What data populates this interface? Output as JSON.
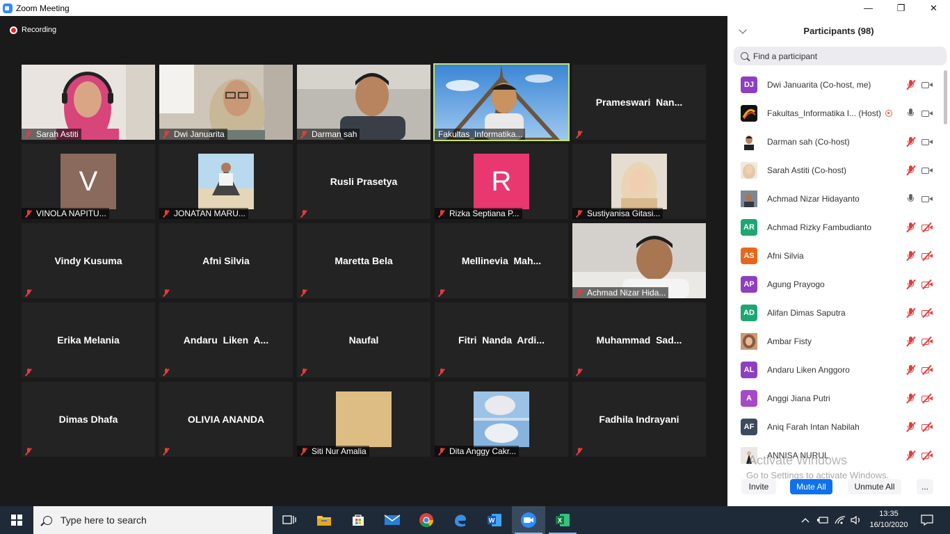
{
  "window": {
    "title": "Zoom Meeting",
    "controls": [
      "—",
      "❐",
      "✕"
    ]
  },
  "meeting": {
    "recording_label": "Recording",
    "tiles": [
      {
        "name": "Sarah Astiti",
        "kind": "video",
        "photo": "woman-pink-hijab-headset"
      },
      {
        "name": "Dwi Januarita",
        "kind": "video",
        "photo": "woman-hijab-glasses"
      },
      {
        "name": "Darman sah",
        "kind": "video",
        "photo": "man-dark-shirt"
      },
      {
        "name": "Fakultas_Informatika...",
        "kind": "video",
        "photo": "man-eiffel-tower",
        "active_speaker": true
      },
      {
        "name": "Prameswari  Nan...",
        "kind": "name"
      },
      {
        "name": "VINOLA NAPITU...",
        "kind": "avatar",
        "letter": "V",
        "color": "#8a6a5c"
      },
      {
        "name": "JONATAN MARU...",
        "kind": "picture",
        "photo": "man-beach-chair"
      },
      {
        "name": "Rusli Prasetya",
        "kind": "name"
      },
      {
        "name": "Rizka Septiana P...",
        "kind": "avatar",
        "letter": "R",
        "color": "#e8386f"
      },
      {
        "name": "Sustiyanisa Gitasi...",
        "kind": "picture",
        "photo": "woman-hijab-portrait"
      },
      {
        "name": "Vindy Kusuma",
        "kind": "name"
      },
      {
        "name": "Afni Silvia",
        "kind": "name"
      },
      {
        "name": "Maretta Bela",
        "kind": "name"
      },
      {
        "name": "Mellinevia  Mah...",
        "kind": "name"
      },
      {
        "name": "Achmad Nizar Hida...",
        "kind": "video",
        "photo": "man-white-room"
      },
      {
        "name": "Erika Melania",
        "kind": "name"
      },
      {
        "name": "Andaru  Liken  A...",
        "kind": "name"
      },
      {
        "name": "Naufal",
        "kind": "name"
      },
      {
        "name": "Fitri  Nanda  Ardi...",
        "kind": "name"
      },
      {
        "name": "Muhammad  Sad...",
        "kind": "name"
      },
      {
        "name": "Dimas Dhafa",
        "kind": "name"
      },
      {
        "name": "OLIVIA ANANDA",
        "kind": "name"
      },
      {
        "name": "Siti Nur Amalia",
        "kind": "picture",
        "photo": "tan-square"
      },
      {
        "name": "Dita Anggy Cakr...",
        "kind": "picture",
        "photo": "collage-photos"
      },
      {
        "name": "Fadhila Indrayani",
        "kind": "name"
      }
    ]
  },
  "participants": {
    "title": "Participants (98)",
    "search_placeholder": "Find a participant",
    "list": [
      {
        "name": "Dwi Januarita (Co-host, me)",
        "initials": "DJ",
        "color": "#8e3fc1",
        "mic": "muted",
        "cam": "on"
      },
      {
        "name": "Fakultas_Informatika I... (Host)",
        "initials": "",
        "color": "#2b2b2b",
        "logo": true,
        "mic": "on",
        "cam": "on",
        "hosting": true
      },
      {
        "name": "Darman sah (Co-host)",
        "initials": "",
        "color": "#5a6a7a",
        "mic": "muted",
        "cam": "on"
      },
      {
        "name": "Sarah Astiti (Co-host)",
        "initials": "",
        "color": "#d9c2a8",
        "mic": "muted",
        "cam": "on"
      },
      {
        "name": "Achmad Nizar Hidayanto",
        "initials": "",
        "color": "#4a5663",
        "mic": "on",
        "cam": "on"
      },
      {
        "name": "Achmad Rizky Fambudianto",
        "initials": "AR",
        "color": "#1ea672",
        "mic": "muted",
        "cam": "off"
      },
      {
        "name": "Afni Silvia",
        "initials": "AS",
        "color": "#e8671d",
        "mic": "muted",
        "cam": "off"
      },
      {
        "name": "Agung Prayogo",
        "initials": "AP",
        "color": "#8e3fc1",
        "mic": "muted",
        "cam": "off"
      },
      {
        "name": "Alifan Dimas Saputra",
        "initials": "AD",
        "color": "#1ea672",
        "mic": "muted",
        "cam": "off"
      },
      {
        "name": "Ambar Fisty",
        "initials": "",
        "color": "#b07a5a",
        "mic": "muted",
        "cam": "off"
      },
      {
        "name": "Andaru Liken Anggoro",
        "initials": "AL",
        "color": "#8e3fc1",
        "mic": "muted",
        "cam": "off"
      },
      {
        "name": "Anggi Jiana Putri",
        "initials": "A",
        "color": "#a549c8",
        "mic": "muted",
        "cam": "off"
      },
      {
        "name": "Aniq Farah Intan Nabilah",
        "initials": "AF",
        "color": "#3b4a5c",
        "mic": "muted",
        "cam": "off"
      },
      {
        "name": "ANNISA NURUL",
        "initials": "",
        "color": "#e9e4df",
        "mic": "muted",
        "cam": "off"
      }
    ],
    "watermark_title": "Activate Windows",
    "watermark_sub": "Go to Settings to activate Windows.",
    "buttons": {
      "invite": "Invite",
      "mute_all": "Mute All",
      "unmute_all": "Unmute All",
      "more": "..."
    }
  },
  "taskbar": {
    "search_placeholder": "Type here to search",
    "apps": [
      "task-view",
      "file-explorer",
      "microsoft-store",
      "mail",
      "chrome",
      "edge",
      "word",
      "zoom",
      "excel"
    ],
    "time": "13:35",
    "date": "16/10/2020"
  },
  "colors": {
    "meeting_bg": "#1a1a1a",
    "tile_bg": "#232323",
    "active_border": "#c6e46a",
    "mute_red": "#e43d3d",
    "zoom_blue": "#0e72ed",
    "taskbar": "#1f2a38"
  }
}
